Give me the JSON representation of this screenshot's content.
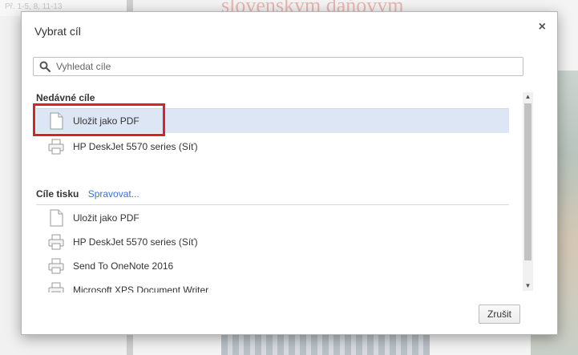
{
  "background": {
    "left_text": "Př. 1-5, 8, 11-13",
    "page_title": "slovenským daňovým"
  },
  "dialog": {
    "title": "Vybrat cíl",
    "close_label": "×",
    "search_placeholder": "Vyhledat cíle",
    "recent": {
      "header": "Nedávné cíle",
      "items": [
        {
          "label": "Uložit jako PDF",
          "icon": "document-icon",
          "selected": true
        },
        {
          "label": "HP DeskJet 5570 series (Síť)",
          "icon": "printer-icon",
          "selected": false
        }
      ]
    },
    "print_destinations": {
      "header": "Cíle tisku",
      "manage_link": "Spravovat...",
      "items": [
        {
          "label": "Uložit jako PDF",
          "icon": "document-icon"
        },
        {
          "label": "HP DeskJet 5570 series (Síť)",
          "icon": "printer-icon"
        },
        {
          "label": "Send To OneNote 2016",
          "icon": "printer-icon"
        },
        {
          "label": "Microsoft XPS Document Writer",
          "icon": "printer-icon"
        }
      ]
    },
    "cancel_label": "Zrušit"
  },
  "colors": {
    "selected_row": "#dde6f5",
    "highlight_box": "#d9232b",
    "link": "#3a6fd8"
  }
}
